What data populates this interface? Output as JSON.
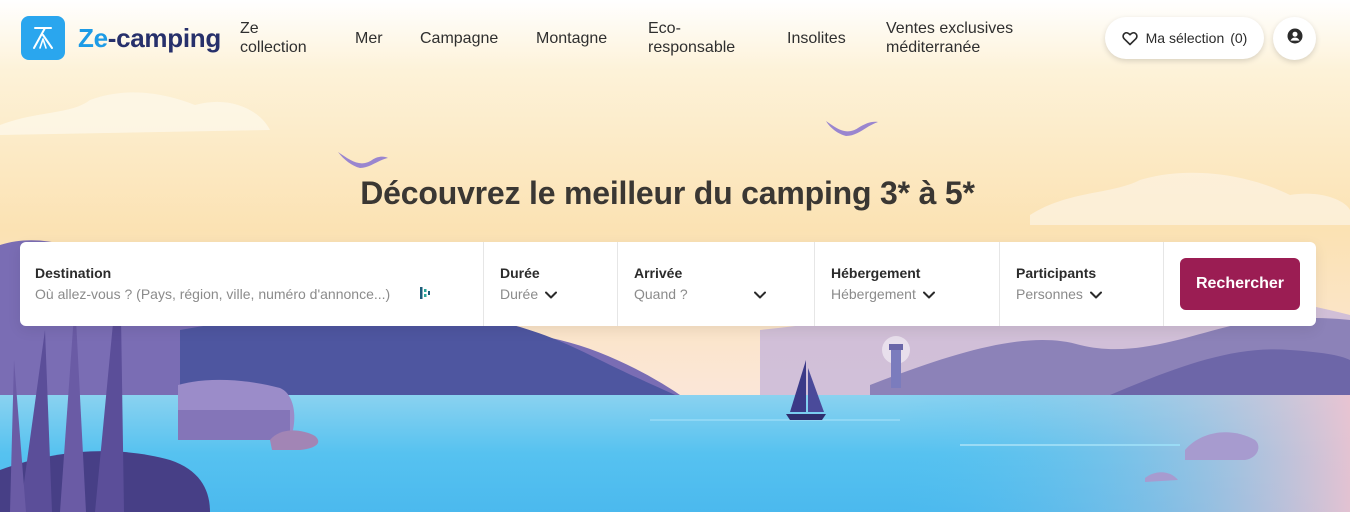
{
  "brand": {
    "part1": "Ze",
    "part2": "-camping"
  },
  "nav": {
    "items": [
      {
        "line1": "Ze",
        "line2": "collection"
      },
      {
        "line1": "Mer",
        "line2": ""
      },
      {
        "line1": "Campagne",
        "line2": ""
      },
      {
        "line1": "Montagne",
        "line2": ""
      },
      {
        "line1": "Eco-",
        "line2": "responsable"
      },
      {
        "line1": "Insolites",
        "line2": ""
      },
      {
        "line1": "Ventes exclusives",
        "line2": "méditerranée"
      }
    ]
  },
  "selection": {
    "label": "Ma sélection",
    "count": "(0)"
  },
  "icons": {
    "heart": "heart-icon",
    "user": "user-icon",
    "chevron": "chevron-down-icon",
    "locate": "locate-icon",
    "logo": "tent-icon"
  },
  "hero": {
    "title": "Découvrez le meilleur du camping 3* à 5*"
  },
  "search": {
    "destination": {
      "label": "Destination",
      "placeholder": "Où allez-vous ? (Pays, région, ville, numéro d'annonce...)"
    },
    "duree": {
      "label": "Durée",
      "value": "Durée"
    },
    "arrivee": {
      "label": "Arrivée",
      "value": "Quand ?"
    },
    "hebergement": {
      "label": "Hébergement",
      "value": "Hébergement"
    },
    "participants": {
      "label": "Participants",
      "value": "Personnes"
    },
    "button": "Rechercher"
  },
  "colors": {
    "brand_blue": "#1d9be6",
    "brand_navy": "#27306b",
    "cta": "#9b1d53"
  }
}
